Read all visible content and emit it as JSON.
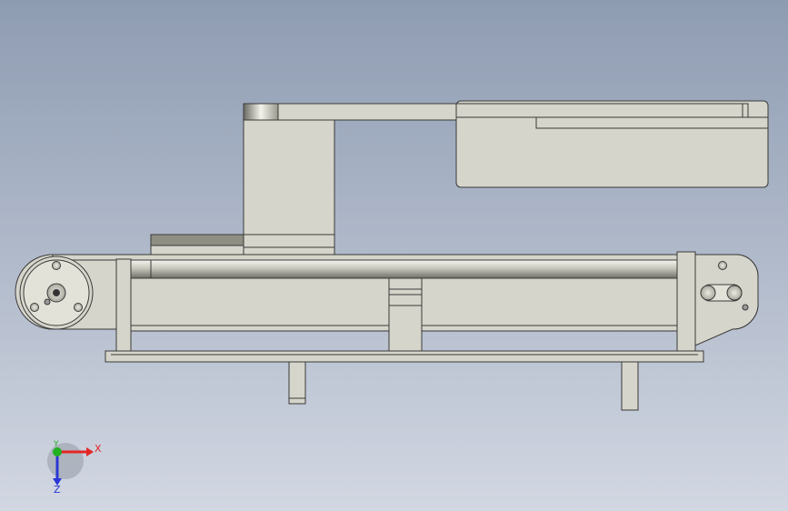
{
  "viewport": {
    "background_top": "#8e9cb2",
    "background_bottom": "#d2d7e2",
    "part_fill": "#d6d5cb",
    "part_edge": "#3a3a3a"
  },
  "triad": {
    "x_label": "X",
    "y_label": "Y",
    "z_label": "Z",
    "x_color": "#e32626",
    "y_color": "#21b021",
    "z_color": "#2a36d6"
  }
}
